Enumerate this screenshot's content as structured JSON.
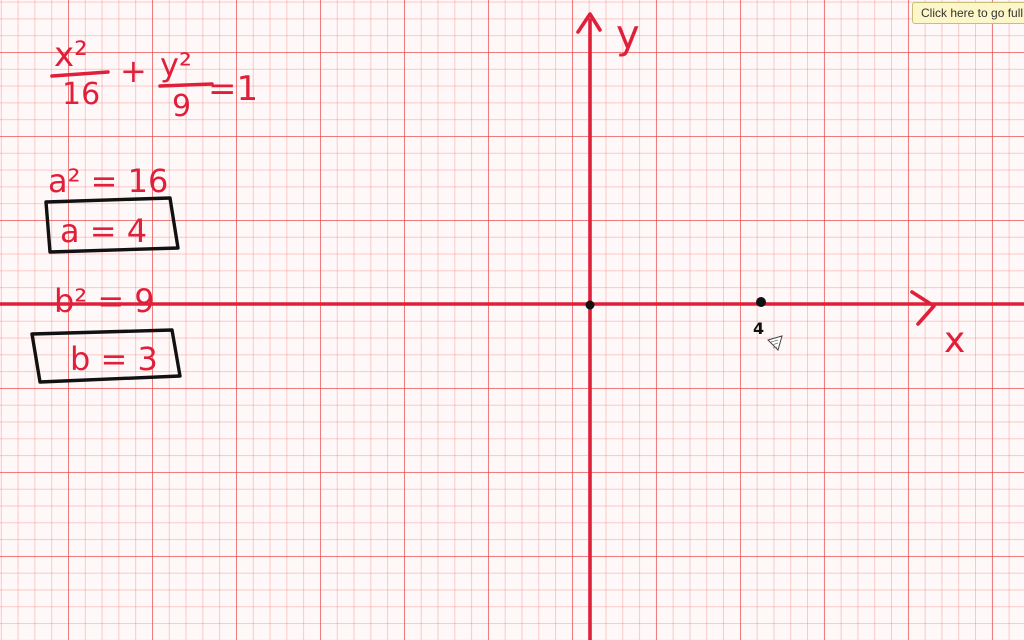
{
  "whiteboard": {
    "tooltip_text": "Click here to go full",
    "equation": {
      "x_term_num": "x²",
      "x_term_den": "16",
      "plus": "+",
      "y_term_num": "y²",
      "y_term_den": "9",
      "equals": "=1"
    },
    "steps": [
      {
        "text": "a² = 16",
        "boxed": false
      },
      {
        "text": "a = 4",
        "boxed": true
      },
      {
        "text": "b² = 9",
        "boxed": false
      },
      {
        "text": "b = 3",
        "boxed": true
      }
    ],
    "axes": {
      "y_label": "y",
      "x_label": "x"
    },
    "point_label": "4",
    "colors": {
      "grid": "#f07080",
      "ink_red": "#e0203a",
      "ink_black": "#111111",
      "tooltip_bg": "#fdf6c8"
    }
  }
}
